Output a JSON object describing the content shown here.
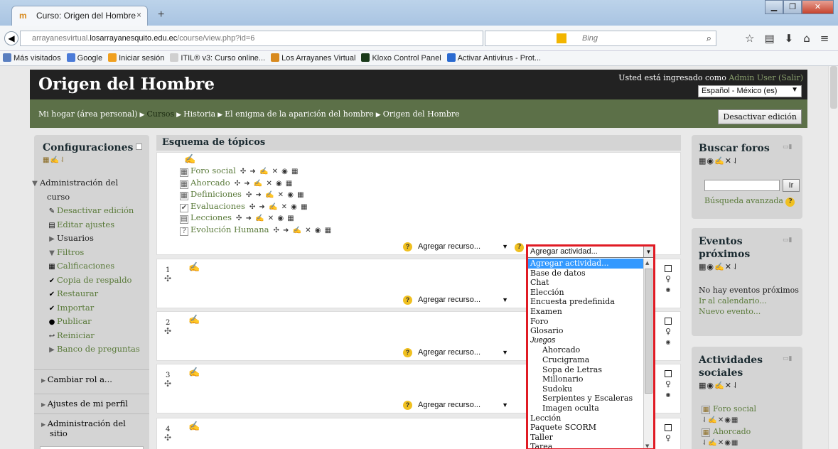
{
  "browser": {
    "tab_title": "Curso: Origen del Hombre",
    "new_tab": "+",
    "url_prefix": "arrayanesvirtual.",
    "url_domain": "losarrayanesquito.edu.ec",
    "url_path": "/course/view.php?id=6",
    "search_placeholder": "Bing",
    "bookmarks": [
      {
        "label": "Más visitados",
        "color": "#5a7fc0"
      },
      {
        "label": "Google",
        "color": "#4b7bd8"
      },
      {
        "label": "Iniciar sesión",
        "color": "#f0a020"
      },
      {
        "label": "ITIL® v3: Curso online...",
        "color": "#d0d0d0"
      },
      {
        "label": "Los Arrayanes Virtual",
        "color": "#d88a1f"
      },
      {
        "label": "Kloxo Control Panel",
        "color": "#1a3a1a"
      },
      {
        "label": "Activar Antivirus - Prot...",
        "color": "#2a6ad0"
      }
    ]
  },
  "header": {
    "site_title": "Origen del Hombre",
    "login_prefix": "Usted está ingresado como ",
    "user_name": "Admin User",
    "logout": "(Salir)",
    "language": "Español - México (es)"
  },
  "breadcrumb": {
    "items": [
      "Mi hogar (área personal)",
      "Cursos",
      "Historia",
      "El enigma de la aparición del hombre",
      "Origen del Hombre"
    ],
    "edit_button": "Desactivar edición"
  },
  "settings_block": {
    "title": "Configuraciones",
    "items": [
      {
        "label": "Administración del",
        "type": "plain",
        "icon": "▼"
      },
      {
        "label": "curso",
        "type": "plain",
        "icon": ""
      },
      {
        "label": "Desactivar edición",
        "type": "link",
        "icon": "✎"
      },
      {
        "label": "Editar ajustes",
        "type": "link",
        "icon": "▤"
      },
      {
        "label": "Usuarios",
        "type": "plain",
        "icon": "▶"
      },
      {
        "label": "Filtros",
        "type": "link",
        "icon": "▼"
      },
      {
        "label": "Calificaciones",
        "type": "link",
        "icon": "▦"
      },
      {
        "label": "Copia de respaldo",
        "type": "link",
        "icon": "✔"
      },
      {
        "label": "Restaurar",
        "type": "link",
        "icon": "✔"
      },
      {
        "label": "Importar",
        "type": "link",
        "icon": "✔"
      },
      {
        "label": "Publicar",
        "type": "link",
        "icon": "●"
      },
      {
        "label": "Reiniciar",
        "type": "link",
        "icon": "↩"
      },
      {
        "label": "Banco de preguntas",
        "type": "link",
        "icon": "▶"
      }
    ],
    "sections": [
      "Cambiar rol a...",
      "Ajustes de mi perfil",
      "Administración del",
      "sitio"
    ]
  },
  "topics": {
    "title": "Esquema de tópicos",
    "activities": [
      {
        "label": "Foro social",
        "icon": "▦"
      },
      {
        "label": "Ahorcado",
        "icon": "▦"
      },
      {
        "label": "Definiciones",
        "icon": "▦"
      },
      {
        "label": "Evaluaciones",
        "icon": "✔"
      },
      {
        "label": "Lecciones",
        "icon": "▤"
      },
      {
        "label": "Evolución Humana",
        "icon": "?"
      }
    ],
    "activity_tools": "✣ ➜ ✍ ✕ ◉ ▦",
    "section_numbers": [
      "1",
      "2",
      "3",
      "4"
    ],
    "add_resource": "Agregar recurso...",
    "add_activity": "Agregar actividad..."
  },
  "activity_dropdown": {
    "selected": "Agregar actividad...",
    "options": [
      {
        "label": "Agregar actividad...",
        "kind": "sel"
      },
      {
        "label": "Base de datos",
        "kind": "item"
      },
      {
        "label": "Chat",
        "kind": "item"
      },
      {
        "label": "Elección",
        "kind": "item"
      },
      {
        "label": "Encuesta predefinida",
        "kind": "item"
      },
      {
        "label": "Examen",
        "kind": "item"
      },
      {
        "label": "Foro",
        "kind": "item"
      },
      {
        "label": "Glosario",
        "kind": "item"
      },
      {
        "label": "Juegos",
        "kind": "group"
      },
      {
        "label": "Ahorcado",
        "kind": "sub"
      },
      {
        "label": "Crucigrama",
        "kind": "sub"
      },
      {
        "label": "Sopa de Letras",
        "kind": "sub"
      },
      {
        "label": "Millonario",
        "kind": "sub"
      },
      {
        "label": "Sudoku",
        "kind": "sub"
      },
      {
        "label": "Serpientes y Escaleras",
        "kind": "sub"
      },
      {
        "label": "Imagen oculta",
        "kind": "sub"
      },
      {
        "label": "Lección",
        "kind": "item"
      },
      {
        "label": "Paquete SCORM",
        "kind": "item"
      },
      {
        "label": "Taller",
        "kind": "item"
      },
      {
        "label": "Tarea",
        "kind": "item"
      }
    ],
    "highlight_color": "#e01b24"
  },
  "search_forums": {
    "title": "Buscar foros",
    "go": "Ir",
    "advanced": "Búsqueda avanzada"
  },
  "upcoming_events": {
    "title_line1": "Eventos",
    "title_line2": "próximos",
    "empty": "No hay eventos próximos",
    "calendar": "Ir al calendario...",
    "new_event": "Nuevo evento..."
  },
  "social_activities": {
    "title_line1": "Actividades",
    "title_line2": "sociales",
    "items": [
      "Foro social",
      "Ahorcado"
    ]
  }
}
